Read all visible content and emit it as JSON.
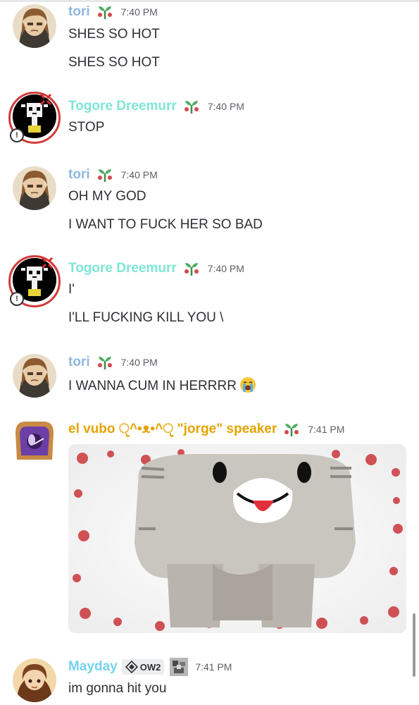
{
  "messages": [
    {
      "author": "tori",
      "time": "7:40 PM",
      "lines": [
        "SHES SO HOT",
        "SHES SO HOT"
      ]
    },
    {
      "author": "Togore Dreemurr",
      "time": "7:40 PM",
      "lines": [
        "STOP"
      ]
    },
    {
      "author": "tori",
      "time": "7:40 PM",
      "lines": [
        "OH MY GOD",
        "I WANT TO FUCK HER SO BAD"
      ]
    },
    {
      "author": "Togore Dreemurr",
      "time": "7:40 PM",
      "lines": [
        "I'",
        "I'LL FUCKING KILL YOU \\"
      ]
    },
    {
      "author": "tori",
      "time": "7:40 PM",
      "lines": [
        "I WANNA CUM IN HERRRR"
      ],
      "emoji": "loudly-crying-face-icon"
    },
    {
      "author": "el vubo ੵ^•ᴥ•^ੵ \"jorge\" speaker",
      "time": "7:41 PM",
      "attachment": "image"
    },
    {
      "author": "Mayday",
      "tag": "OW2",
      "time": "7:41 PM",
      "lines": [
        "im gonna hit you"
      ]
    }
  ],
  "colors": {
    "tori": "#8fb8e2",
    "togore": "#7fe6d4",
    "vubo": "#e3a400",
    "mayday": "#76d1f2",
    "text": "#2e3035",
    "timestamp": "#5c5e66"
  },
  "icons": {
    "role": "plant-role-icon",
    "tag": "game-tag-icon"
  }
}
